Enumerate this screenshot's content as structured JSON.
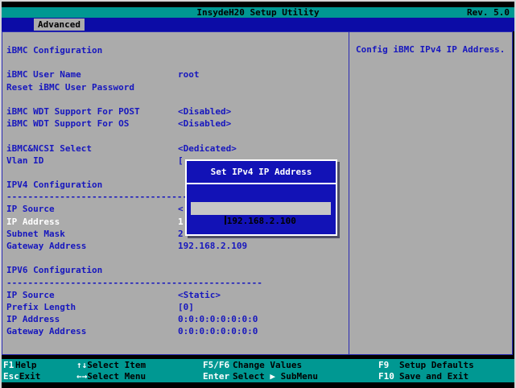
{
  "titlebar": {
    "title": "InsydeH20 Setup Utility",
    "rev": "Rev. 5.0"
  },
  "menubar": {
    "tabs": [
      {
        "label": "Advanced",
        "active": true
      }
    ]
  },
  "colors": {
    "teal": "#009892",
    "menu_blue": "#0c0ca6",
    "dialog_blue": "#1212b6",
    "content_gray": "#ababab",
    "text_blue": "#1717be",
    "selected_text": "#ffffff",
    "input_gray": "#c6c6c6"
  },
  "left_pane": {
    "separator_text": "------------------------------------------------",
    "rows": [
      {
        "type": "heading",
        "label": "iBMC Configuration"
      },
      {
        "type": "blank"
      },
      {
        "type": "item",
        "label": "iBMC User Name",
        "value": "root"
      },
      {
        "type": "item",
        "label": "Reset iBMC User Password",
        "value": ""
      },
      {
        "type": "blank"
      },
      {
        "type": "item",
        "label": "iBMC WDT Support For POST",
        "value": "<Disabled>"
      },
      {
        "type": "item",
        "label": "iBMC WDT Support For OS",
        "value": "<Disabled>"
      },
      {
        "type": "blank"
      },
      {
        "type": "item",
        "label": "iBMC&NCSI Select",
        "value": "<Dedicated>"
      },
      {
        "type": "item",
        "label": "Vlan ID",
        "value": "["
      },
      {
        "type": "blank"
      },
      {
        "type": "heading",
        "label": "IPV4 Configuration"
      },
      {
        "type": "separator"
      },
      {
        "type": "item",
        "label": "IP Source",
        "value": "<"
      },
      {
        "type": "item",
        "label": "IP Address",
        "value": "1",
        "selected": true
      },
      {
        "type": "item",
        "label": "Subnet Mask",
        "value": "2"
      },
      {
        "type": "item",
        "label": "Gateway Address",
        "value": "192.168.2.109"
      },
      {
        "type": "blank"
      },
      {
        "type": "heading",
        "label": "IPV6 Configuration"
      },
      {
        "type": "separator"
      },
      {
        "type": "item",
        "label": "IP Source",
        "value": "<Static>"
      },
      {
        "type": "item",
        "label": "Prefix Length",
        "value": "[0]"
      },
      {
        "type": "item",
        "label": "IP Address",
        "value": "0:0:0:0:0:0:0:0"
      },
      {
        "type": "item",
        "label": "Gateway Address",
        "value": "0:0:0:0:0:0:0:0"
      }
    ]
  },
  "right_pane": {
    "help_text": "Config iBMC IPv4 IP Address."
  },
  "dialog": {
    "title": "Set IPv4 IP Address",
    "input_value": "192.168.2.100"
  },
  "help_bar": {
    "rows": [
      [
        {
          "key": "F1",
          "label": "Help"
        },
        {
          "key": "↑↓",
          "label": "Select Item"
        },
        {
          "key": "F5/F6",
          "label": "Change Values"
        },
        {
          "key": "F9",
          "label": "Setup Defaults"
        }
      ],
      [
        {
          "key": "Esc",
          "label": "Exit"
        },
        {
          "key": "←→",
          "label": "Select Menu"
        },
        {
          "key": "Enter",
          "label": "Select ▶ SubMenu"
        },
        {
          "key": "F10",
          "label": "Save and Exit"
        }
      ]
    ]
  }
}
